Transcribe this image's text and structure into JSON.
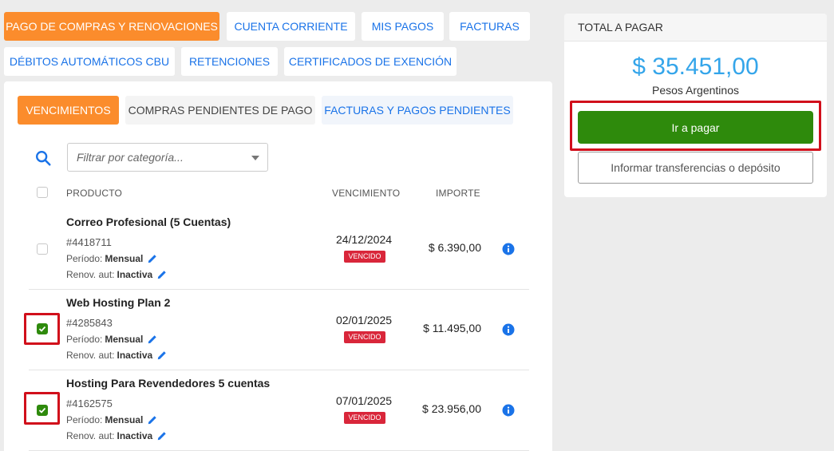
{
  "top_tabs": [
    {
      "label": "PAGO DE COMPRAS Y RENOVACIONES"
    },
    {
      "label": "CUENTA CORRIENTE"
    },
    {
      "label": "MIS PAGOS"
    },
    {
      "label": "FACTURAS"
    },
    {
      "label": "DÉBITOS AUTOMÁTICOS CBU"
    },
    {
      "label": "RETENCIONES"
    },
    {
      "label": "CERTIFICADOS DE EXENCIÓN"
    }
  ],
  "sub_tabs": [
    {
      "label": "VENCIMIENTOS"
    },
    {
      "label": "COMPRAS PENDIENTES DE PAGO"
    },
    {
      "label": "FACTURAS Y PAGOS PENDIENTES"
    }
  ],
  "filter": {
    "placeholder": "Filtrar por categoría..."
  },
  "table": {
    "headers": {
      "product": "PRODUCTO",
      "due": "VENCIMIENTO",
      "amount": "IMPORTE"
    },
    "rows": [
      {
        "name": "Correo Profesional (5 Cuentas)",
        "id": "#4418711",
        "period_label": "Período:",
        "period": "Mensual",
        "renov_label": "Renov. aut:",
        "renov": "Inactiva",
        "date": "24/12/2024",
        "status": "VENCIDO",
        "amount": "$ 6.390,00",
        "checked": false
      },
      {
        "name": "Web Hosting Plan 2",
        "id": "#4285843",
        "period_label": "Período:",
        "period": "Mensual",
        "renov_label": "Renov. aut:",
        "renov": "Inactiva",
        "date": "02/01/2025",
        "status": "VENCIDO",
        "amount": "$ 11.495,00",
        "checked": true
      },
      {
        "name": "Hosting Para Revendedores 5 cuentas",
        "id": "#4162575",
        "period_label": "Período:",
        "period": "Mensual",
        "renov_label": "Renov. aut:",
        "renov": "Inactiva",
        "date": "07/01/2025",
        "status": "VENCIDO",
        "amount": "$ 23.956,00",
        "checked": true
      }
    ]
  },
  "summary": {
    "header": "TOTAL A PAGAR",
    "total": "$ 35.451,00",
    "currency": "Pesos Argentinos",
    "pay_button": "Ir a pagar",
    "transfer_button": "Informar transferencias o depósito"
  },
  "colors": {
    "accent": "#fb8c2c",
    "link": "#1a73e8",
    "pay": "#2e8a0c",
    "total": "#34a5ea",
    "badge": "#d9263a",
    "highlight": "#d10f1b"
  }
}
